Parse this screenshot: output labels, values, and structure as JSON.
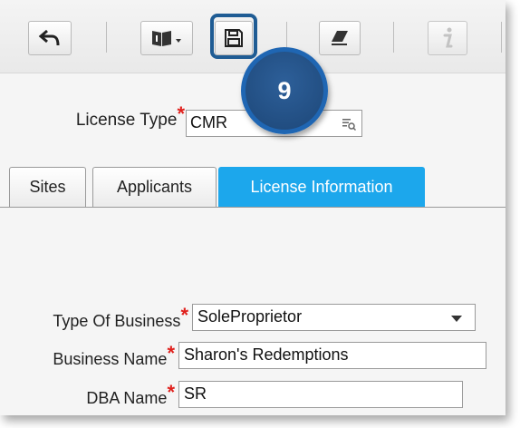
{
  "toolbar": {
    "buttons": [
      {
        "icon": "undo-arrow-icon"
      },
      {
        "icon": "book-menu-icon"
      },
      {
        "icon": "save-icon"
      },
      {
        "icon": "eraser-icon"
      },
      {
        "icon": "info-icon"
      }
    ],
    "step_number": "9"
  },
  "license_type": {
    "label": "License Type",
    "value": "CMR",
    "lookup_icon": "lookup-icon"
  },
  "tabs": [
    {
      "label": "Sites",
      "active": false
    },
    {
      "label": "Applicants",
      "active": false
    },
    {
      "label": "License Information",
      "active": true
    }
  ],
  "form": {
    "type_of_business": {
      "label": "Type Of Business",
      "value": "SoleProprietor"
    },
    "business_name": {
      "label": "Business Name",
      "value": "Sharon's Redemptions"
    },
    "dba_name": {
      "label": "DBA Name",
      "value": "SR"
    }
  },
  "colors": {
    "active_tab": "#1ca7ec",
    "highlight": "#1f5c94",
    "required": "#e0201c"
  }
}
